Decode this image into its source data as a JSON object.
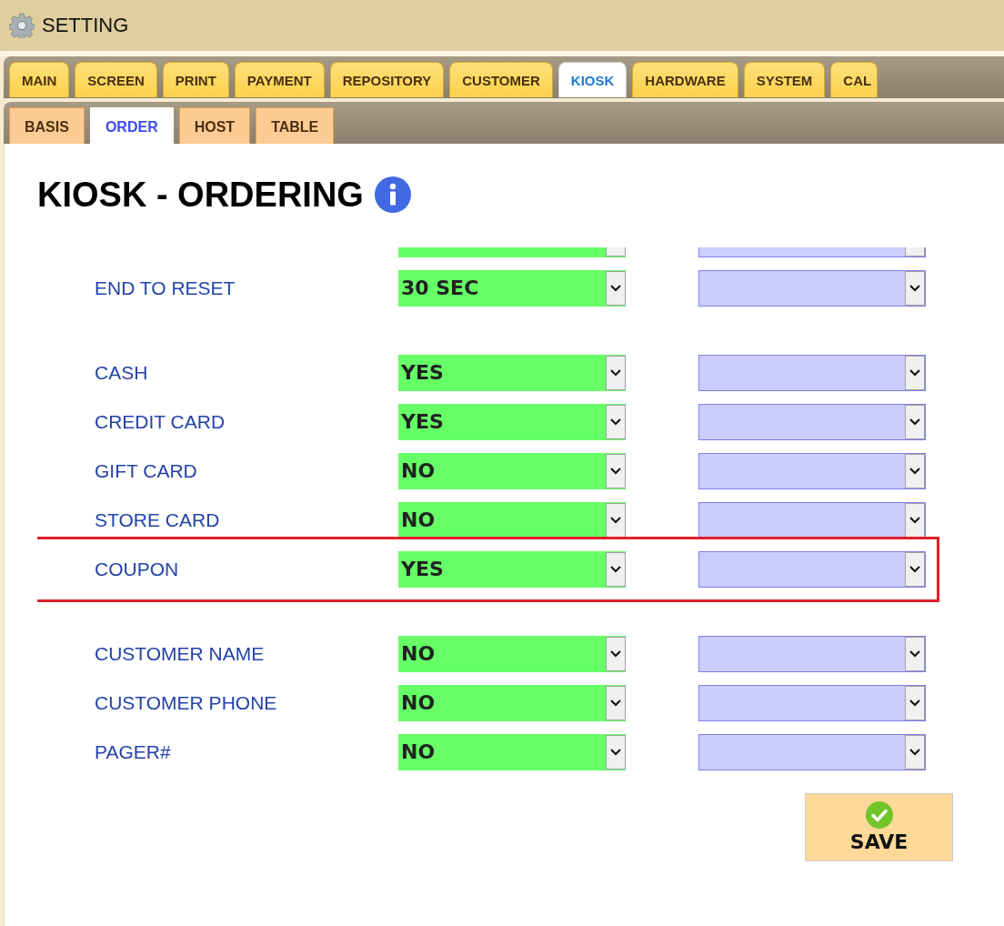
{
  "window": {
    "title": "SETTING"
  },
  "tabs": [
    {
      "label": "MAIN",
      "selected": false
    },
    {
      "label": "SCREEN",
      "selected": false
    },
    {
      "label": "PRINT",
      "selected": false
    },
    {
      "label": "PAYMENT",
      "selected": false
    },
    {
      "label": "REPOSITORY",
      "selected": false
    },
    {
      "label": "CUSTOMER",
      "selected": false
    },
    {
      "label": "KIOSK",
      "selected": true
    },
    {
      "label": "HARDWARE",
      "selected": false
    },
    {
      "label": "SYSTEM",
      "selected": false
    },
    {
      "label": "CAL",
      "selected": false
    }
  ],
  "subtabs": [
    {
      "label": "BASIS",
      "selected": false
    },
    {
      "label": "ORDER",
      "selected": true
    },
    {
      "label": "HOST",
      "selected": false
    },
    {
      "label": "TABLE",
      "selected": false
    }
  ],
  "heading": "KIOSK - ORDERING",
  "groups": [
    {
      "rows": [
        {
          "kind": "clipped",
          "highlighted": false
        },
        {
          "kind": "setting",
          "label": "END TO RESET",
          "value": "30 SEC",
          "highlighted": false
        }
      ]
    },
    {
      "rows": [
        {
          "kind": "setting",
          "label": "CASH",
          "value": "YES",
          "highlighted": false
        },
        {
          "kind": "setting",
          "label": "CREDIT CARD",
          "value": "YES",
          "highlighted": false
        },
        {
          "kind": "setting",
          "label": "GIFT CARD",
          "value": "NO",
          "highlighted": false
        },
        {
          "kind": "setting",
          "label": "STORE CARD",
          "value": "NO",
          "highlighted": false
        },
        {
          "kind": "setting",
          "label": "COUPON",
          "value": "YES",
          "highlighted": true
        }
      ]
    },
    {
      "rows": [
        {
          "kind": "setting",
          "label": "CUSTOMER NAME",
          "value": "NO",
          "highlighted": false
        },
        {
          "kind": "setting",
          "label": "CUSTOMER PHONE",
          "value": "NO",
          "highlighted": false
        },
        {
          "kind": "setting",
          "label": "PAGER#",
          "value": "NO",
          "highlighted": false
        }
      ]
    }
  ],
  "save_button": {
    "label": "SAVE"
  }
}
